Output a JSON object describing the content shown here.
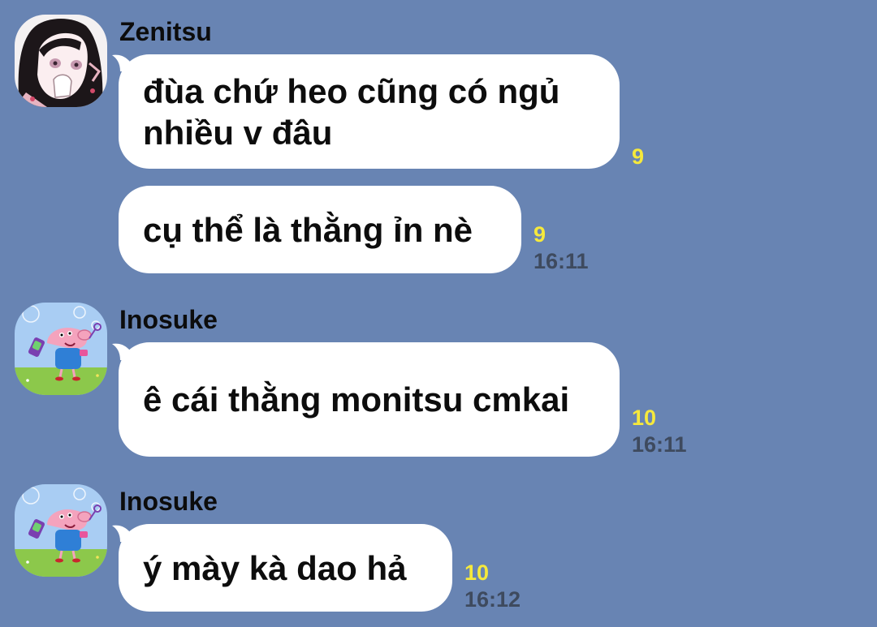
{
  "colors": {
    "background": "#6884b3",
    "bubble": "#ffffff",
    "read_count": "#f6e93c",
    "timestamp": "#3e4a5e"
  },
  "messages": [
    {
      "sender": "Zenitsu",
      "avatar_icon": "anime-girl-avatar-icon",
      "text": "đùa chứ heo cũng có ngủ nhiều v đâu",
      "read_count": "9",
      "time": ""
    },
    {
      "sender": "",
      "text": "cụ thể là thằng ỉn nè",
      "read_count": "9",
      "time": "16:11"
    },
    {
      "sender": "Inosuke",
      "avatar_icon": "pig-cartoon-avatar-icon",
      "text": "ê cái thằng monitsu cmkai",
      "read_count": "10",
      "time": "16:11"
    },
    {
      "sender": "Inosuke",
      "avatar_icon": "pig-cartoon-avatar-icon",
      "text": "ý mày kà dao hả",
      "read_count": "10",
      "time": "16:12"
    }
  ]
}
